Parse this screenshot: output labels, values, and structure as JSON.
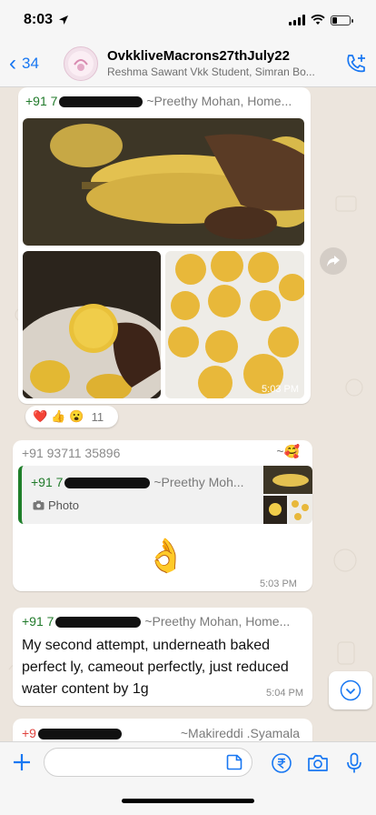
{
  "status": {
    "time": "8:03"
  },
  "header": {
    "back_count": "34",
    "title": "OvkkliveMacrons27thJuly22",
    "subtitle": "Reshma Sawant Vkk Student, Simran Bo..."
  },
  "messages": [
    {
      "sender_prefix": "+91 7",
      "sender_tag": "~Preethy Mohan, Home...",
      "time": "5:03 PM"
    },
    {
      "sender": "+91 93711 35896",
      "sender_tag_emoji": "🥰",
      "quote": {
        "sender_prefix": "+91 7",
        "sender_tag": "~Preethy Moh...",
        "type_label": "Photo"
      },
      "emoji": "👌",
      "time": "5:03 PM"
    },
    {
      "sender_prefix": "+91 7",
      "sender_tag": "~Preethy Mohan, Home...",
      "text": "My second attempt, underneath baked perfect ly, cameout perfectly, just reduced water content by 1g",
      "time": "5:04 PM"
    },
    {
      "sender_prefix": "+9",
      "sender_tag": "~Makireddi .Syamala"
    }
  ],
  "reactions": {
    "emojis": [
      "❤️",
      "👍",
      "😮"
    ],
    "count": "11"
  },
  "input": {
    "placeholder": ""
  },
  "colors": {
    "accent": "#1877f2",
    "sender_green": "#207a2a",
    "chat_bg": "#ece5dd",
    "macaron_yellow": "#e8c44a"
  },
  "icons": [
    "chevron-left-icon",
    "location-arrow-icon",
    "signal-icon",
    "wifi-icon",
    "battery-icon",
    "add-participant-call-icon",
    "forward-icon",
    "camera-icon",
    "plus-icon",
    "sticker-icon",
    "rupee-payment-icon",
    "microphone-icon",
    "chevron-down-icon"
  ]
}
